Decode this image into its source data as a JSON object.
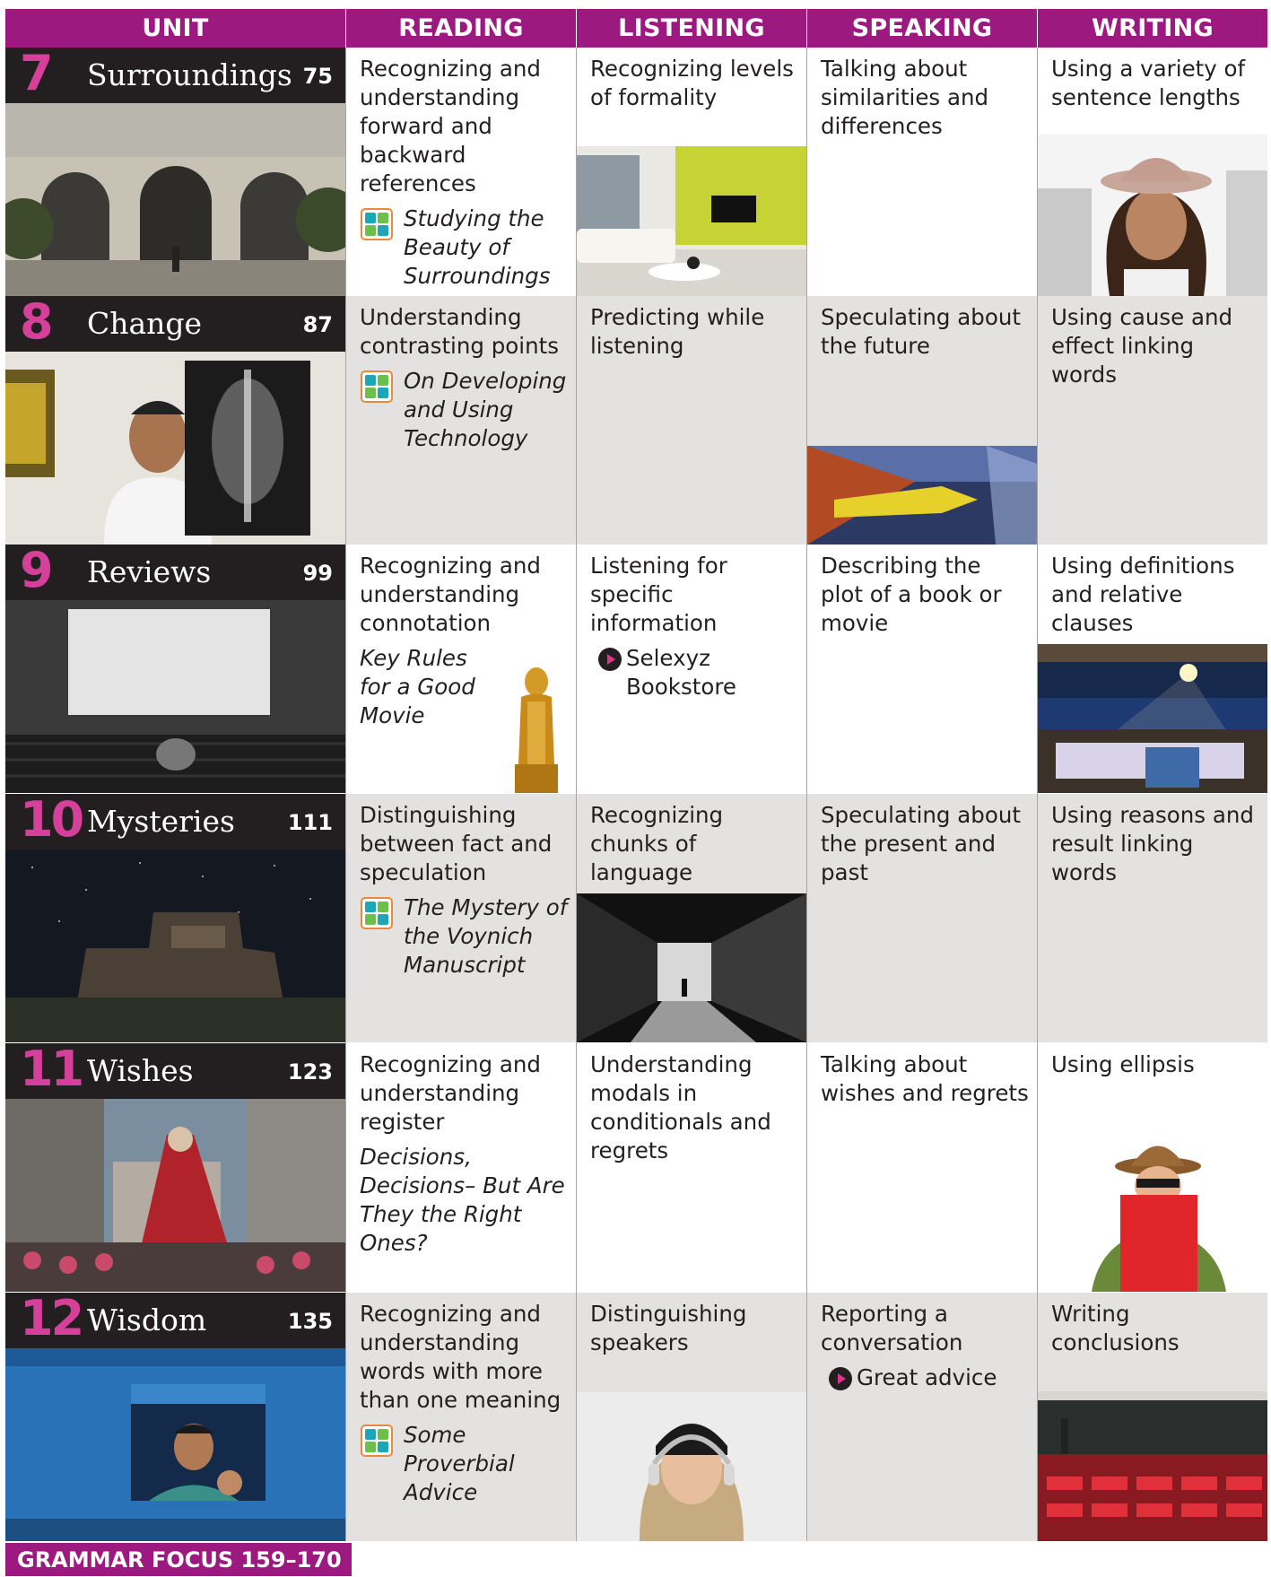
{
  "header": {
    "unit": "UNIT",
    "reading": "READING",
    "listening": "LISTENING",
    "speaking": "SPEAKING",
    "writing": "WRITING"
  },
  "units": [
    {
      "number": "7",
      "name": "Surroundings",
      "page": "75",
      "reading": {
        "skill": "Recognizing and understanding forward and backward references",
        "title": "Studying the Beauty of Surroundings",
        "badge": "qr"
      },
      "listening": {
        "skill": "Recognizing levels of formality"
      },
      "speaking": {
        "skill": "Talking about similarities and differences"
      },
      "writing": {
        "skill": "Using a variety of sentence lengths"
      }
    },
    {
      "number": "8",
      "name": "Change",
      "page": "87",
      "reading": {
        "skill": "Understanding contrasting points",
        "title": "On Developing and Using Technology",
        "badge": "qr"
      },
      "listening": {
        "skill": "Predicting while listening"
      },
      "speaking": {
        "skill": "Speculating about the future"
      },
      "writing": {
        "skill": "Using cause and effect linking words"
      }
    },
    {
      "number": "9",
      "name": "Reviews",
      "page": "99",
      "reading": {
        "skill": "Recognizing and understanding connotation",
        "title": "Key Rules for a Good Movie"
      },
      "listening": {
        "skill": "Listening for specific information",
        "video": "Selexyz Bookstore"
      },
      "speaking": {
        "skill": "Describing the plot of a book or movie"
      },
      "writing": {
        "skill": "Using definitions and relative clauses"
      }
    },
    {
      "number": "10",
      "name": "Mysteries",
      "page": "111",
      "reading": {
        "skill": "Distinguishing between fact and speculation",
        "title": "The Mystery of the Voynich Manuscript",
        "badge": "qr"
      },
      "listening": {
        "skill": "Recognizing chunks of language"
      },
      "speaking": {
        "skill": "Speculating about the present and past"
      },
      "writing": {
        "skill": "Using reasons and result linking words"
      }
    },
    {
      "number": "11",
      "name": "Wishes",
      "page": "123",
      "reading": {
        "skill": "Recognizing and understanding register",
        "title": "Decisions, Decisions– But Are They the Right Ones?"
      },
      "listening": {
        "skill": "Understanding modals in conditionals and regrets"
      },
      "speaking": {
        "skill": "Talking about wishes and regrets"
      },
      "writing": {
        "skill": "Using ellipsis"
      }
    },
    {
      "number": "12",
      "name": "Wisdom",
      "page": "135",
      "reading": {
        "skill": "Recognizing and understanding words with more than one meaning",
        "title": "Some Proverbial Advice",
        "badge": "qr"
      },
      "listening": {
        "skill": "Distinguishing speakers"
      },
      "speaking": {
        "skill": "Reporting a conversation",
        "video": "Great advice"
      },
      "writing": {
        "skill": "Writing conclusions"
      }
    }
  ],
  "footer": {
    "grammar_focus": "GRAMMAR FOCUS  159–170"
  },
  "colors": {
    "accent": "#9c1a7f",
    "unit_number": "#d4409a",
    "unit_bar": "#231f20",
    "shade": "#e4e1e1"
  }
}
